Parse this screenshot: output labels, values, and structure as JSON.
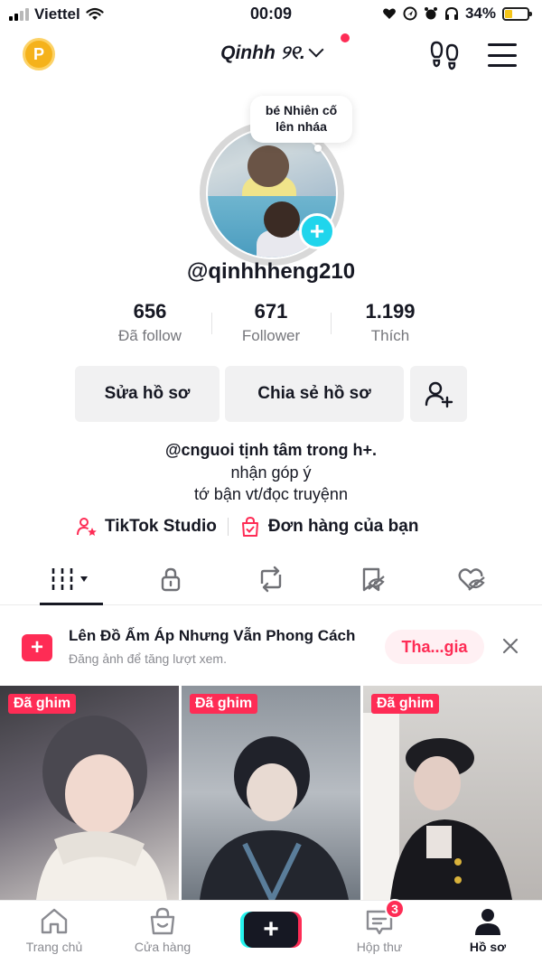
{
  "status_bar": {
    "carrier": "Viettel",
    "time": "00:09",
    "battery": "34%",
    "battery_level": 0.34
  },
  "header": {
    "coin_letter": "P",
    "profile_title": "Qinhh ୨୧."
  },
  "profile": {
    "note_line1": "bé Nhiên cố",
    "note_line2": "lên nháa",
    "username": "@qinhhheng210"
  },
  "stats": [
    {
      "value": "656",
      "label": "Đã follow"
    },
    {
      "value": "671",
      "label": "Follower"
    },
    {
      "value": "1.199",
      "label": "Thích"
    }
  ],
  "buttons": {
    "edit_profile": "Sửa hồ sơ",
    "share_profile": "Chia sẻ hồ sơ"
  },
  "bio": {
    "line1": "@cnguoi tịnh tâm trong h+.",
    "line2": "nhận góp ý",
    "line3": "tớ bận vt/đọc truyệnn"
  },
  "links": {
    "studio": "TikTok Studio",
    "orders": "Đơn hàng của bạn"
  },
  "banner": {
    "title": "Lên Đồ Ấm Áp Nhưng Vẫn Phong Cách",
    "subtitle": "Đăng ảnh để tăng lượt xem.",
    "cta": "Tha...gia"
  },
  "videos": [
    {
      "badge": "Đã ghim"
    },
    {
      "badge": "Đã ghim"
    },
    {
      "badge": "Đã ghim"
    }
  ],
  "bottom_nav": {
    "home": "Trang chủ",
    "shop": "Cửa hàng",
    "inbox": "Hộp thư",
    "inbox_badge": "3",
    "profile": "Hồ sơ"
  },
  "colors": {
    "accent": "#fe2c55",
    "cyan": "#20d5ec",
    "coin": "#f5b21b"
  }
}
